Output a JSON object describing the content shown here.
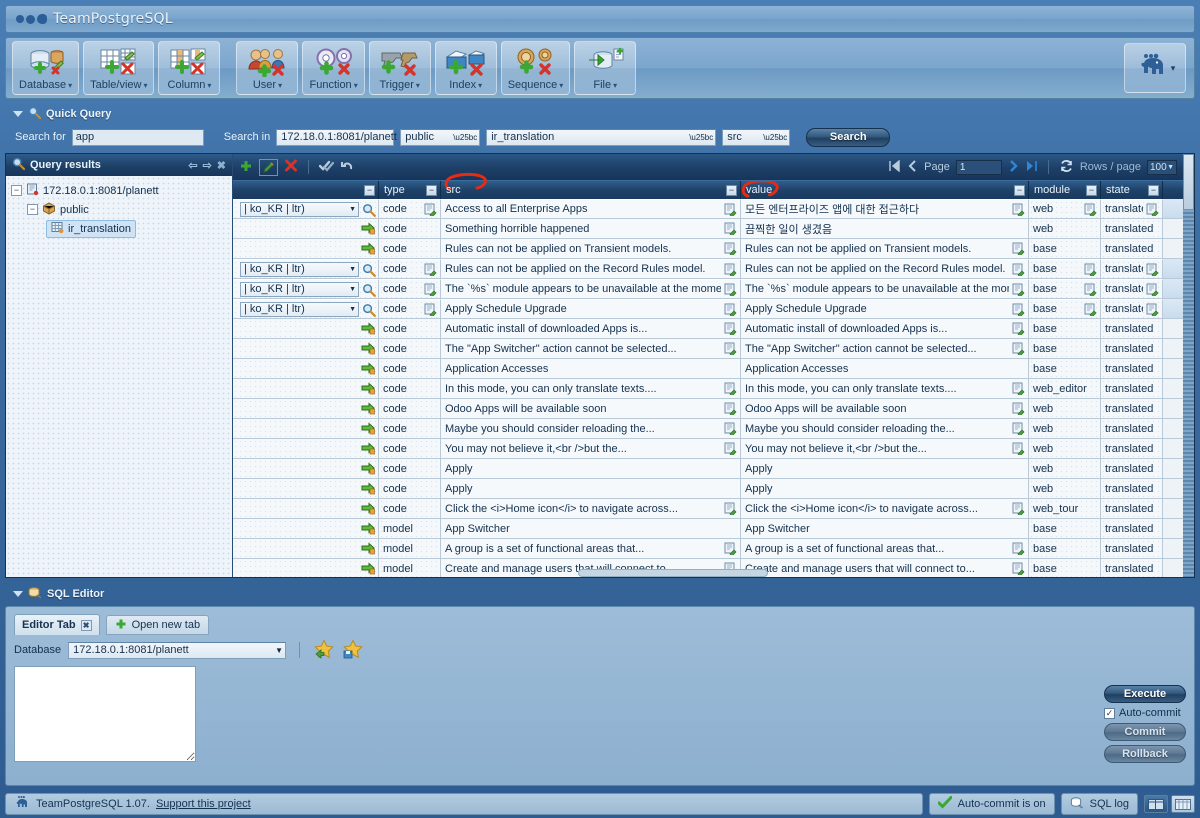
{
  "app": {
    "title": "TeamPostgreSQL"
  },
  "toolbar": {
    "buttons": [
      {
        "label": "Database",
        "caret": "▾",
        "icon": "database-icon"
      },
      {
        "label": "Table/view",
        "caret": "▾",
        "icon": "table-icon"
      },
      {
        "label": "Column",
        "caret": "▾",
        "icon": "column-icon"
      },
      {
        "label": "User",
        "caret": "▾",
        "icon": "user-icon"
      },
      {
        "label": "Function",
        "caret": "▾",
        "icon": "function-icon"
      },
      {
        "label": "Trigger",
        "caret": "▾",
        "icon": "trigger-icon"
      },
      {
        "label": "Index",
        "caret": "▾",
        "icon": "index-icon"
      },
      {
        "label": "Sequence",
        "caret": "▾",
        "icon": "sequence-icon"
      },
      {
        "label": "File",
        "caret": "▾",
        "icon": "file-icon"
      }
    ],
    "profile_caret": "▾"
  },
  "quick_query": {
    "title": "Quick Query",
    "search_for_label": "Search for",
    "search_for_value": "app",
    "search_in_label": "Search in",
    "server": "172.18.0.1:8081/planett",
    "schema": "public",
    "table": "ir_translation",
    "column": "src",
    "search_button": "Search"
  },
  "query_results": {
    "title": "Query results",
    "tree": {
      "server": "172.18.0.1:8081/planett",
      "schema": "public",
      "table": "ir_translation"
    }
  },
  "grid_toolbar": {
    "page_label": "Page",
    "page_value": "1",
    "rows_per_page_label": "Rows / page",
    "rows_per_page_value": "100"
  },
  "grid": {
    "columns": [
      {
        "key": "lang",
        "label": ""
      },
      {
        "key": "type",
        "label": "type"
      },
      {
        "key": "src",
        "label": "src",
        "annotated": true
      },
      {
        "key": "value",
        "label": "value",
        "annotated": true
      },
      {
        "key": "module",
        "label": "module"
      },
      {
        "key": "state",
        "label": "state"
      }
    ],
    "rows": [
      {
        "lang": "| ko_KR | ltr)",
        "type": "code",
        "src": "Access to all Enterprise Apps",
        "value": "모든 엔터프라이즈 앱에 대한 접근하다",
        "module": "web",
        "state": "translated",
        "highlight": true
      },
      {
        "lang": "",
        "type": "code",
        "src": "Something horrible happened",
        "value": "끔찍한 일이 생겼음",
        "module": "web",
        "state": "translated",
        "highlight": false
      },
      {
        "lang": "",
        "type": "code",
        "src": "Rules can not be applied on Transient models.",
        "value": "Rules can not be applied on Transient models.",
        "module": "base",
        "state": "translated",
        "highlight": false
      },
      {
        "lang": "| ko_KR | ltr)",
        "type": "code",
        "src": "Rules can not be applied on the Record Rules model.",
        "value": "Rules can not be applied on the Record Rules model.",
        "module": "base",
        "state": "translated",
        "highlight": true
      },
      {
        "lang": "| ko_KR | ltr)",
        "type": "code",
        "src": "The `%s` module appears to be unavailable at the moment,",
        "value": "The `%s` module appears to be unavailable at the moment,",
        "module": "base",
        "state": "translated",
        "highlight": true
      },
      {
        "lang": "| ko_KR | ltr)",
        "type": "code",
        "src": "Apply Schedule Upgrade",
        "value": "Apply Schedule Upgrade",
        "module": "base",
        "state": "translated",
        "highlight": true
      },
      {
        "lang": "",
        "type": "code",
        "src": "Automatic install of downloaded Apps is...",
        "value": "Automatic install of downloaded Apps is...",
        "module": "base",
        "state": "translated",
        "highlight": false
      },
      {
        "lang": "",
        "type": "code",
        "src": "The \"App Switcher\" action cannot be selected...",
        "value": "The \"App Switcher\" action cannot be selected...",
        "module": "base",
        "state": "translated",
        "highlight": false
      },
      {
        "lang": "",
        "type": "code",
        "src": "Application Accesses",
        "value": "Application Accesses",
        "module": "base",
        "state": "translated",
        "highlight": false
      },
      {
        "lang": "",
        "type": "code",
        "src": "In this mode, you can only translate texts....",
        "value": "In this mode, you can only translate texts....",
        "module": "web_editor",
        "state": "translated",
        "highlight": false
      },
      {
        "lang": "",
        "type": "code",
        "src": "Odoo Apps will be available soon",
        "value": "Odoo Apps will be available soon",
        "module": "web",
        "state": "translated",
        "highlight": false
      },
      {
        "lang": "",
        "type": "code",
        "src": "Maybe you should consider reloading the...",
        "value": "Maybe you should consider reloading the...",
        "module": "web",
        "state": "translated",
        "highlight": false
      },
      {
        "lang": "",
        "type": "code",
        "src": "You may not believe it,<br />but the...",
        "value": "You may not believe it,<br />but the...",
        "module": "web",
        "state": "translated",
        "highlight": false
      },
      {
        "lang": "",
        "type": "code",
        "src": "Apply",
        "value": "Apply",
        "module": "web",
        "state": "translated",
        "highlight": false
      },
      {
        "lang": "",
        "type": "code",
        "src": "Apply",
        "value": "Apply",
        "module": "web",
        "state": "translated",
        "highlight": false
      },
      {
        "lang": "",
        "type": "code",
        "src": "Click the <i>Home icon</i> to navigate across...",
        "value": "Click the <i>Home icon</i> to navigate across...",
        "module": "web_tour",
        "state": "translated",
        "highlight": false
      },
      {
        "lang": "",
        "type": "model",
        "src": "App Switcher",
        "value": "App Switcher",
        "module": "base",
        "state": "translated",
        "highlight": false
      },
      {
        "lang": "",
        "type": "model",
        "src": "A group is a set of functional areas that...",
        "value": "A group is a set of functional areas that...",
        "module": "base",
        "state": "translated",
        "highlight": false
      },
      {
        "lang": "",
        "type": "model",
        "src": "Create and manage users that will connect to...",
        "value": "Create and manage users that will connect to...",
        "module": "base",
        "state": "translated",
        "highlight": false
      }
    ]
  },
  "sql_editor": {
    "title": "SQL Editor",
    "tab_label": "Editor Tab",
    "open_new_tab": "Open new tab",
    "database_label": "Database",
    "database_value": "172.18.0.1:8081/planett",
    "editor_value": "",
    "execute": "Execute",
    "auto_commit": "Auto-commit",
    "commit": "Commit",
    "rollback": "Rollback"
  },
  "status_bar": {
    "product": "TeamPostgreSQL 1.07.",
    "support_link": "Support this project",
    "auto_commit_status": "Auto-commit is on",
    "sql_log": "SQL log"
  },
  "colors": {
    "accent": "#1f4169",
    "annotation": "#e32b16",
    "highlight_row": "#d0e0ef",
    "orange_marker": "#e8a33d"
  }
}
